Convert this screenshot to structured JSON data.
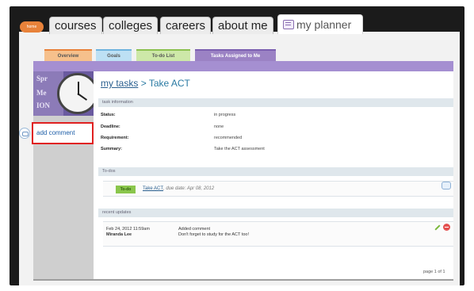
{
  "nav": {
    "home": "home",
    "tabs": [
      "courses",
      "colleges",
      "careers",
      "about me"
    ],
    "active_tab": "my planner"
  },
  "subtabs": [
    "Overview",
    "Goals",
    "To-do List",
    "Tasks Assigned to Me"
  ],
  "sidebar": {
    "image_text": [
      "Spr",
      "Me",
      "ION"
    ],
    "add_comment": "add comment"
  },
  "breadcrumb": {
    "link": "my tasks",
    "sep": ">",
    "current": "Take ACT"
  },
  "task_info": {
    "header": "task information",
    "rows": [
      {
        "k": "Status:",
        "v": "in progress"
      },
      {
        "k": "Deadline:",
        "v": "none"
      },
      {
        "k": "Requirement:",
        "v": "recommended"
      },
      {
        "k": "Summary:",
        "v": "Take the ACT assessment"
      }
    ]
  },
  "todos": {
    "header": "To-dos",
    "badge": "To-do",
    "link": "Take ACT",
    "due": ", due date: Apr 08, 2012"
  },
  "updates": {
    "header": "recent updates",
    "date": "Feb 24, 2012 11:59am",
    "author": "Miranda Lee",
    "action": "Added comment",
    "message": "Don't forget to study for the ACT too!"
  },
  "pager": "page 1 of 1",
  "colors": {
    "accent_purple": "#a58fd1",
    "link_blue": "#2a7aa3",
    "highlight_red": "#e02020"
  }
}
